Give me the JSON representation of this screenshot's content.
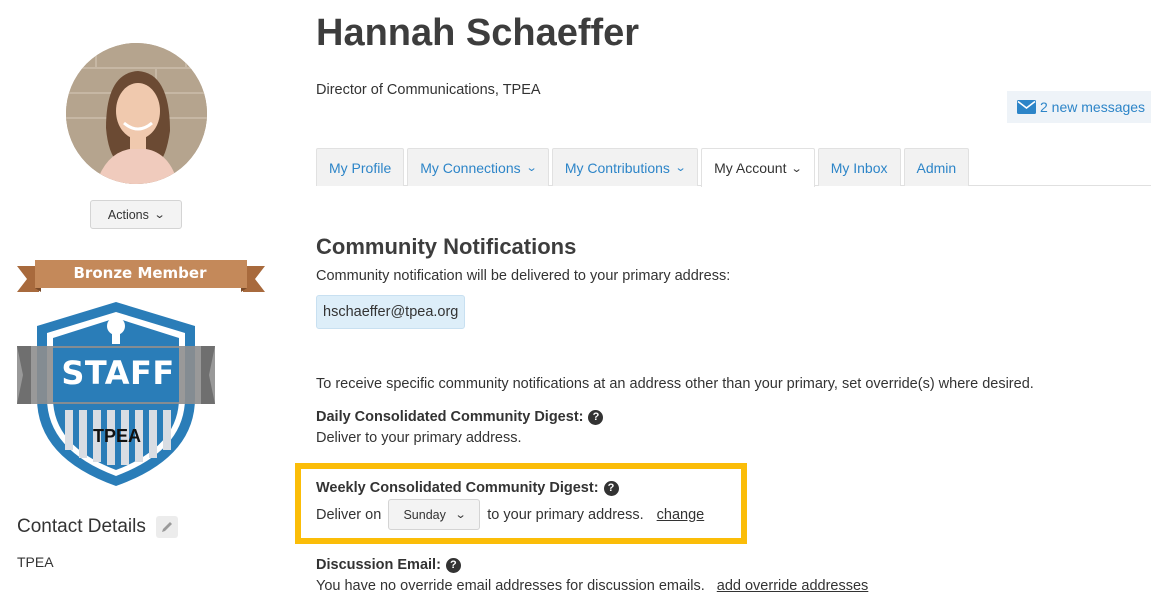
{
  "profile": {
    "name": "Hannah Schaeffer",
    "job_title": "Director of Communications, TPEA",
    "actions_label": "Actions",
    "member_level": "Bronze Member",
    "badge_text": "STAFF",
    "badge_org": "TPEA"
  },
  "contact": {
    "title": "Contact Details",
    "org": "TPEA"
  },
  "messages": {
    "label": "2 new messages"
  },
  "tabs": [
    {
      "label": "My Profile",
      "dropdown": false
    },
    {
      "label": "My Connections",
      "dropdown": true
    },
    {
      "label": "My Contributions",
      "dropdown": true
    },
    {
      "label": "My Account",
      "dropdown": true,
      "active": true
    },
    {
      "label": "My Inbox",
      "dropdown": false
    },
    {
      "label": "Admin",
      "dropdown": false
    }
  ],
  "notifications": {
    "title": "Community Notifications",
    "desc": "Community notification will be delivered to your primary address:",
    "email": "hschaeffer@tpea.org",
    "override_note": "To receive specific community notifications at an address other than your primary, set override(s) where desired.",
    "daily": {
      "label": "Daily Consolidated Community Digest:",
      "text": "Deliver to your primary address."
    },
    "weekly": {
      "label": "Weekly Consolidated Community Digest:",
      "deliver_on": "Deliver on",
      "day": "Sunday",
      "suffix": "to your primary address.",
      "change_link": "change"
    },
    "discussion": {
      "label": "Discussion Email:",
      "text": "You have no override email addresses for discussion emails.",
      "link": "add override addresses"
    }
  },
  "colors": {
    "link": "#2d85c8",
    "highlight": "#fbbd08",
    "ribbon": "#c4895a",
    "badge_blue": "#2a7db8"
  }
}
